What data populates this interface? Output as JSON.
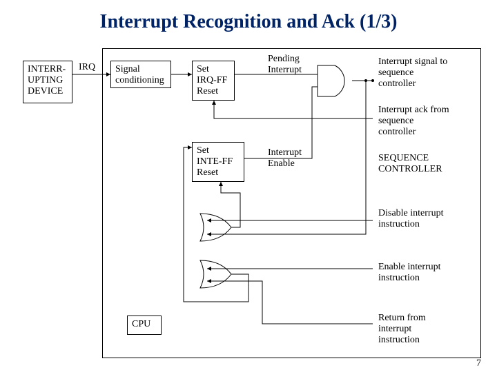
{
  "title": "Interrupt Recognition and Ack (1/3)",
  "boxes": {
    "interrupting_device": "INTERR-\nUPTING\nDEVICE",
    "signal_conditioning": "Signal\nconditioning",
    "irq_ff": "Set\nIRQ-FF\nReset",
    "inte_ff": "Set\nINTE-FF\nReset",
    "cpu": "CPU"
  },
  "labels": {
    "irq": "IRQ",
    "pending_interrupt": "Pending\nInterrupt",
    "interrupt_enable": "Interrupt\nEnable",
    "interrupt_signal": "Interrupt signal to\nsequence\ncontroller",
    "interrupt_ack": "Interrupt ack from\nsequence\ncontroller",
    "sequence_controller": "SEQUENCE\nCONTROLLER",
    "disable_instruction": "Disable interrupt\ninstruction",
    "enable_instruction": "Enable interrupt\ninstruction",
    "return_instruction": "Return from\ninterrupt\ninstruction"
  },
  "page": "7"
}
